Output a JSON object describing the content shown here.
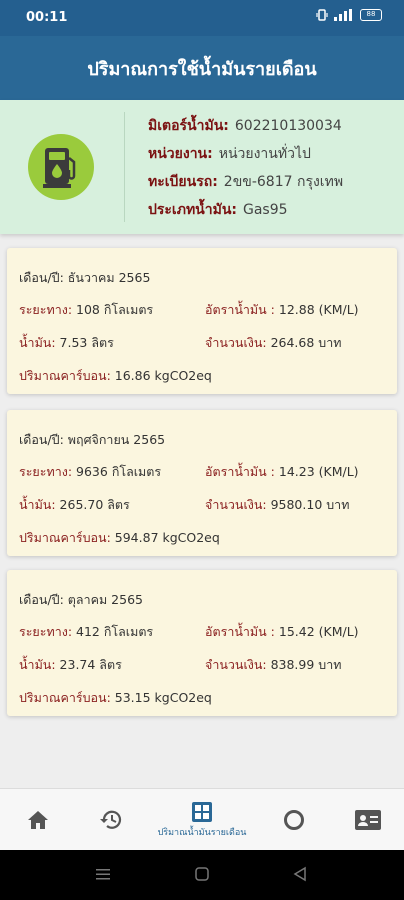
{
  "status": {
    "time": "00:11",
    "signal_text": "ᯤ",
    "battery": "88"
  },
  "header": {
    "title": "ปริมาณการใช้น้ำมันรายเดือน"
  },
  "info": {
    "meter_label": "มิเตอร์น้ำมัน:",
    "meter_value": "602210130034",
    "unit_label": "หน่วยงาน:",
    "unit_value": "หน่วยงานทั่วไป",
    "plate_label": "ทะเบียนรถ:",
    "plate_value": "2ขข-6817 กรุงเทพ",
    "fuel_label": "ประเภทน้ำมัน:",
    "fuel_value": "Gas95"
  },
  "records": [
    {
      "month_label": "เดือน/ปี:",
      "month": "ธันวาคม 2565",
      "distance_label": "ระยะทาง:",
      "distance": "108 กิโลเมตร",
      "rate_label": "อัตราน้ำมัน :",
      "rate": "12.88 (KM/L)",
      "fuel_label": "น้ำมัน:",
      "fuel": "7.53 ลิตร",
      "money_label": "จำนวนเงิน:",
      "money": "264.68 บาท",
      "carbon_label": "ปริมาณคาร์บอน:",
      "carbon": "16.86 kgCO2eq"
    },
    {
      "month_label": "เดือน/ปี:",
      "month": "พฤศจิกายน 2565",
      "distance_label": "ระยะทาง:",
      "distance": "9636 กิโลเมตร",
      "rate_label": "อัตราน้ำมัน :",
      "rate": "14.23 (KM/L)",
      "fuel_label": "น้ำมัน:",
      "fuel": "265.70 ลิตร",
      "money_label": "จำนวนเงิน:",
      "money": "9580.10 บาท",
      "carbon_label": "ปริมาณคาร์บอน:",
      "carbon": "594.87 kgCO2eq"
    },
    {
      "month_label": "เดือน/ปี:",
      "month": "ตุลาคม 2565",
      "distance_label": "ระยะทาง:",
      "distance": "412 กิโลเมตร",
      "rate_label": "อัตราน้ำมัน :",
      "rate": "15.42 (KM/L)",
      "fuel_label": "น้ำมัน:",
      "fuel": "23.74 ลิตร",
      "money_label": "จำนวนเงิน:",
      "money": "838.99 บาท",
      "carbon_label": "ปริมาณคาร์บอน:",
      "carbon": "53.15 kgCO2eq"
    }
  ],
  "nav": {
    "items": [
      "home-icon",
      "history-icon",
      "monthly-grid-icon",
      "circle-icon",
      "contact-card-icon"
    ],
    "active_label": "ปริมาณน้ำมันรายเดือน"
  },
  "colors": {
    "appbar": "#2a6896",
    "info_bg": "#d7f0dd",
    "card_bg": "#fbf6df",
    "label_red": "#8a1f1f",
    "fuel_green": "#9acb3c"
  }
}
